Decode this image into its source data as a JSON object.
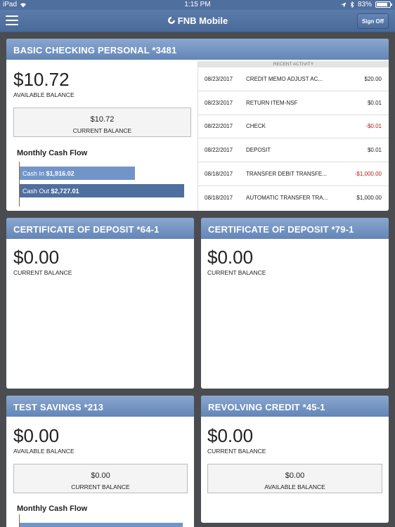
{
  "status_bar": {
    "device": "iPad",
    "time": "1:15 PM",
    "battery": "83%",
    "battery_level": 0.83
  },
  "header": {
    "app_title": "FNB Mobile",
    "menu_icon": "hamburger-menu-icon",
    "sign_off": "Sign Off"
  },
  "checking": {
    "title": "BASIC CHECKING PERSONAL *3481",
    "available_amount": "$10.72",
    "available_label": "AVAILABLE BALANCE",
    "current_amount": "$10.72",
    "current_label": "CURRENT BALANCE",
    "cashflow_title": "Monthly Cash Flow",
    "cash_in_label": "Cash In",
    "cash_in_value": "$1,916.02",
    "cash_out_label": "Cash Out",
    "cash_out_value": "$2,727.01",
    "cash_in_amount": 1916.02,
    "cash_out_amount": 2727.01,
    "recent_activity_title": "RECENT ACTIVITY",
    "transactions": [
      {
        "date": "08/23/2017",
        "desc": "CREDIT MEMO ADJUST AC...",
        "amount": "$20.00",
        "negative": false
      },
      {
        "date": "08/23/2017",
        "desc": "RETURN ITEM-NSF",
        "amount": "$0.01",
        "negative": false
      },
      {
        "date": "08/22/2017",
        "desc": "CHECK",
        "amount": "-$0.01",
        "negative": true
      },
      {
        "date": "08/22/2017",
        "desc": "DEPOSIT",
        "amount": "$0.01",
        "negative": false
      },
      {
        "date": "08/18/2017",
        "desc": "TRANSFER DEBIT TRANSFE...",
        "amount": "-$1,000.00",
        "negative": true
      },
      {
        "date": "08/18/2017",
        "desc": "AUTOMATIC TRANSFER TRA...",
        "amount": "$1,000.00",
        "negative": false
      }
    ]
  },
  "cd1": {
    "title": "CERTIFICATE OF DEPOSIT *64-1",
    "amount": "$0.00",
    "label": "CURRENT BALANCE"
  },
  "cd2": {
    "title": "CERTIFICATE OF DEPOSIT *79-1",
    "amount": "$0.00",
    "label": "CURRENT BALANCE"
  },
  "savings": {
    "title": "TEST SAVINGS *213",
    "amount": "$0.00",
    "label": "AVAILABLE BALANCE",
    "current_amount": "$0.00",
    "current_label": "CURRENT BALANCE",
    "cashflow_title": "Monthly Cash Flow"
  },
  "revolving": {
    "title": "REVOLVING CREDIT *45-1",
    "amount": "$0.00",
    "label": "CURRENT BALANCE",
    "box_amount": "$0.00",
    "box_label": "AVAILABLE BALANCE"
  },
  "colors": {
    "header_blue": "#5b7cab",
    "card_header": "#7797c6",
    "negative_red": "#b21b1b"
  }
}
